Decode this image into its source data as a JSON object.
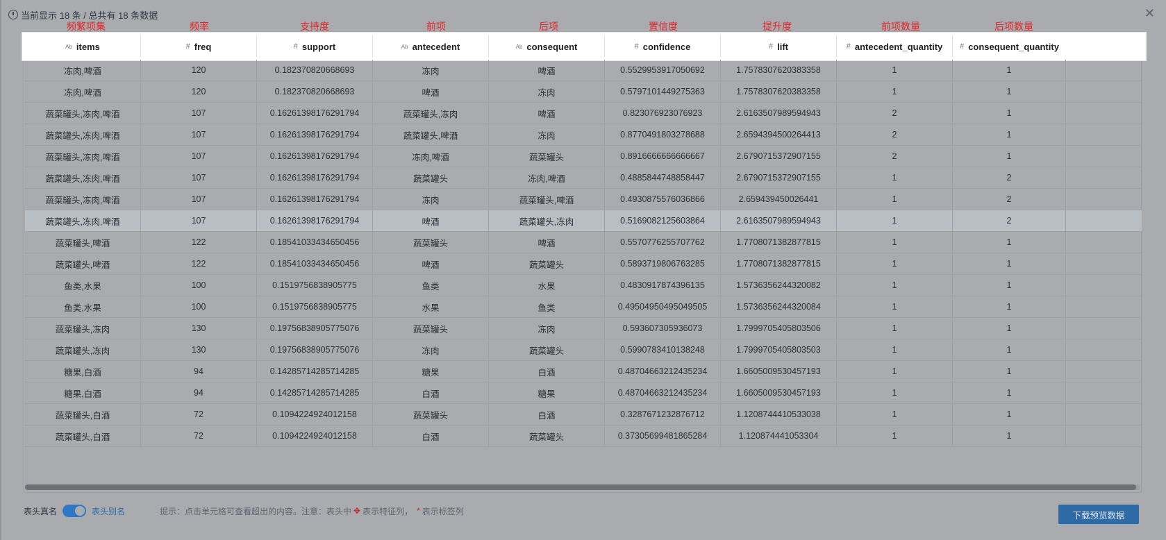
{
  "topbar": {
    "summary": "当前显示 18 条 / 总共有 18 条数据"
  },
  "annotations": [
    "频繁项集",
    "频率",
    "支持度",
    "前项",
    "后项",
    "置信度",
    "提升度",
    "前项数量",
    "后项数量"
  ],
  "columns": [
    {
      "name": "items",
      "type": "Ab"
    },
    {
      "name": "freq",
      "type": "#"
    },
    {
      "name": "support",
      "type": "#"
    },
    {
      "name": "antecedent",
      "type": "Ab"
    },
    {
      "name": "consequent",
      "type": "Ab"
    },
    {
      "name": "confidence",
      "type": "#"
    },
    {
      "name": "lift",
      "type": "#"
    },
    {
      "name": "antecedent_quantity",
      "type": "#"
    },
    {
      "name": "consequent_quantity",
      "type": "#"
    }
  ],
  "rows": [
    [
      "冻肉,啤酒",
      "120",
      "0.182370820668693",
      "冻肉",
      "啤酒",
      "0.5529953917050692",
      "1.7578307620383358",
      "1",
      "1"
    ],
    [
      "冻肉,啤酒",
      "120",
      "0.182370820668693",
      "啤酒",
      "冻肉",
      "0.5797101449275363",
      "1.7578307620383358",
      "1",
      "1"
    ],
    [
      "蔬菜罐头,冻肉,啤酒",
      "107",
      "0.16261398176291794",
      "蔬菜罐头,冻肉",
      "啤酒",
      "0.823076923076923",
      "2.6163507989594943",
      "2",
      "1"
    ],
    [
      "蔬菜罐头,冻肉,啤酒",
      "107",
      "0.16261398176291794",
      "蔬菜罐头,啤酒",
      "冻肉",
      "0.8770491803278688",
      "2.6594394500264413",
      "2",
      "1"
    ],
    [
      "蔬菜罐头,冻肉,啤酒",
      "107",
      "0.16261398176291794",
      "冻肉,啤酒",
      "蔬菜罐头",
      "0.8916666666666667",
      "2.6790715372907155",
      "2",
      "1"
    ],
    [
      "蔬菜罐头,冻肉,啤酒",
      "107",
      "0.16261398176291794",
      "蔬菜罐头",
      "冻肉,啤酒",
      "0.4885844748858447",
      "2.6790715372907155",
      "1",
      "2"
    ],
    [
      "蔬菜罐头,冻肉,啤酒",
      "107",
      "0.16261398176291794",
      "冻肉",
      "蔬菜罐头,啤酒",
      "0.4930875576036866",
      "2.659439450026441",
      "1",
      "2"
    ],
    [
      "蔬菜罐头,冻肉,啤酒",
      "107",
      "0.16261398176291794",
      "啤酒",
      "蔬菜罐头,冻肉",
      "0.5169082125603864",
      "2.6163507989594943",
      "1",
      "2"
    ],
    [
      "蔬菜罐头,啤酒",
      "122",
      "0.18541033434650456",
      "蔬菜罐头",
      "啤酒",
      "0.5570776255707762",
      "1.7708071382877815",
      "1",
      "1"
    ],
    [
      "蔬菜罐头,啤酒",
      "122",
      "0.18541033434650456",
      "啤酒",
      "蔬菜罐头",
      "0.5893719806763285",
      "1.7708071382877815",
      "1",
      "1"
    ],
    [
      "鱼类,水果",
      "100",
      "0.1519756838905775",
      "鱼类",
      "水果",
      "0.4830917874396135",
      "1.5736356244320082",
      "1",
      "1"
    ],
    [
      "鱼类,水果",
      "100",
      "0.1519756838905775",
      "水果",
      "鱼类",
      "0.49504950495049505",
      "1.5736356244320084",
      "1",
      "1"
    ],
    [
      "蔬菜罐头,冻肉",
      "130",
      "0.19756838905775076",
      "蔬菜罐头",
      "冻肉",
      "0.593607305936073",
      "1.7999705405803506",
      "1",
      "1"
    ],
    [
      "蔬菜罐头,冻肉",
      "130",
      "0.19756838905775076",
      "冻肉",
      "蔬菜罐头",
      "0.5990783410138248",
      "1.7999705405803503",
      "1",
      "1"
    ],
    [
      "糖果,白酒",
      "94",
      "0.14285714285714285",
      "糖果",
      "白酒",
      "0.48704663212435234",
      "1.6605009530457193",
      "1",
      "1"
    ],
    [
      "糖果,白酒",
      "94",
      "0.14285714285714285",
      "白酒",
      "糖果",
      "0.48704663212435234",
      "1.6605009530457193",
      "1",
      "1"
    ],
    [
      "蔬菜罐头,白酒",
      "72",
      "0.1094224924012158",
      "蔬菜罐头",
      "白酒",
      "0.3287671232876712",
      "1.1208744410533038",
      "1",
      "1"
    ],
    [
      "蔬菜罐头,白酒",
      "72",
      "0.1094224924012158",
      "白酒",
      "蔬菜罐头",
      "0.37305699481865284",
      "1.120874441053304",
      "1",
      "1"
    ]
  ],
  "selected_row": 7,
  "footer": {
    "real_name_label": "表头真名",
    "alias_label": "表头别名",
    "toggle_on": true,
    "hint_prefix": "提示：点击单元格可查看超出的内容。注意：表头中",
    "hint_feature": "表示特征列，",
    "hint_label": "表示标签列"
  },
  "download_button": "下载预览数据",
  "colors": {
    "accent": "#2e6aa6",
    "annotation": "#e0262a",
    "selected_row": "#b9bec4"
  },
  "icons": {
    "clock": "clock-icon",
    "close": "close-icon",
    "feature": "diamond-icon",
    "label": "asterisk-icon"
  }
}
